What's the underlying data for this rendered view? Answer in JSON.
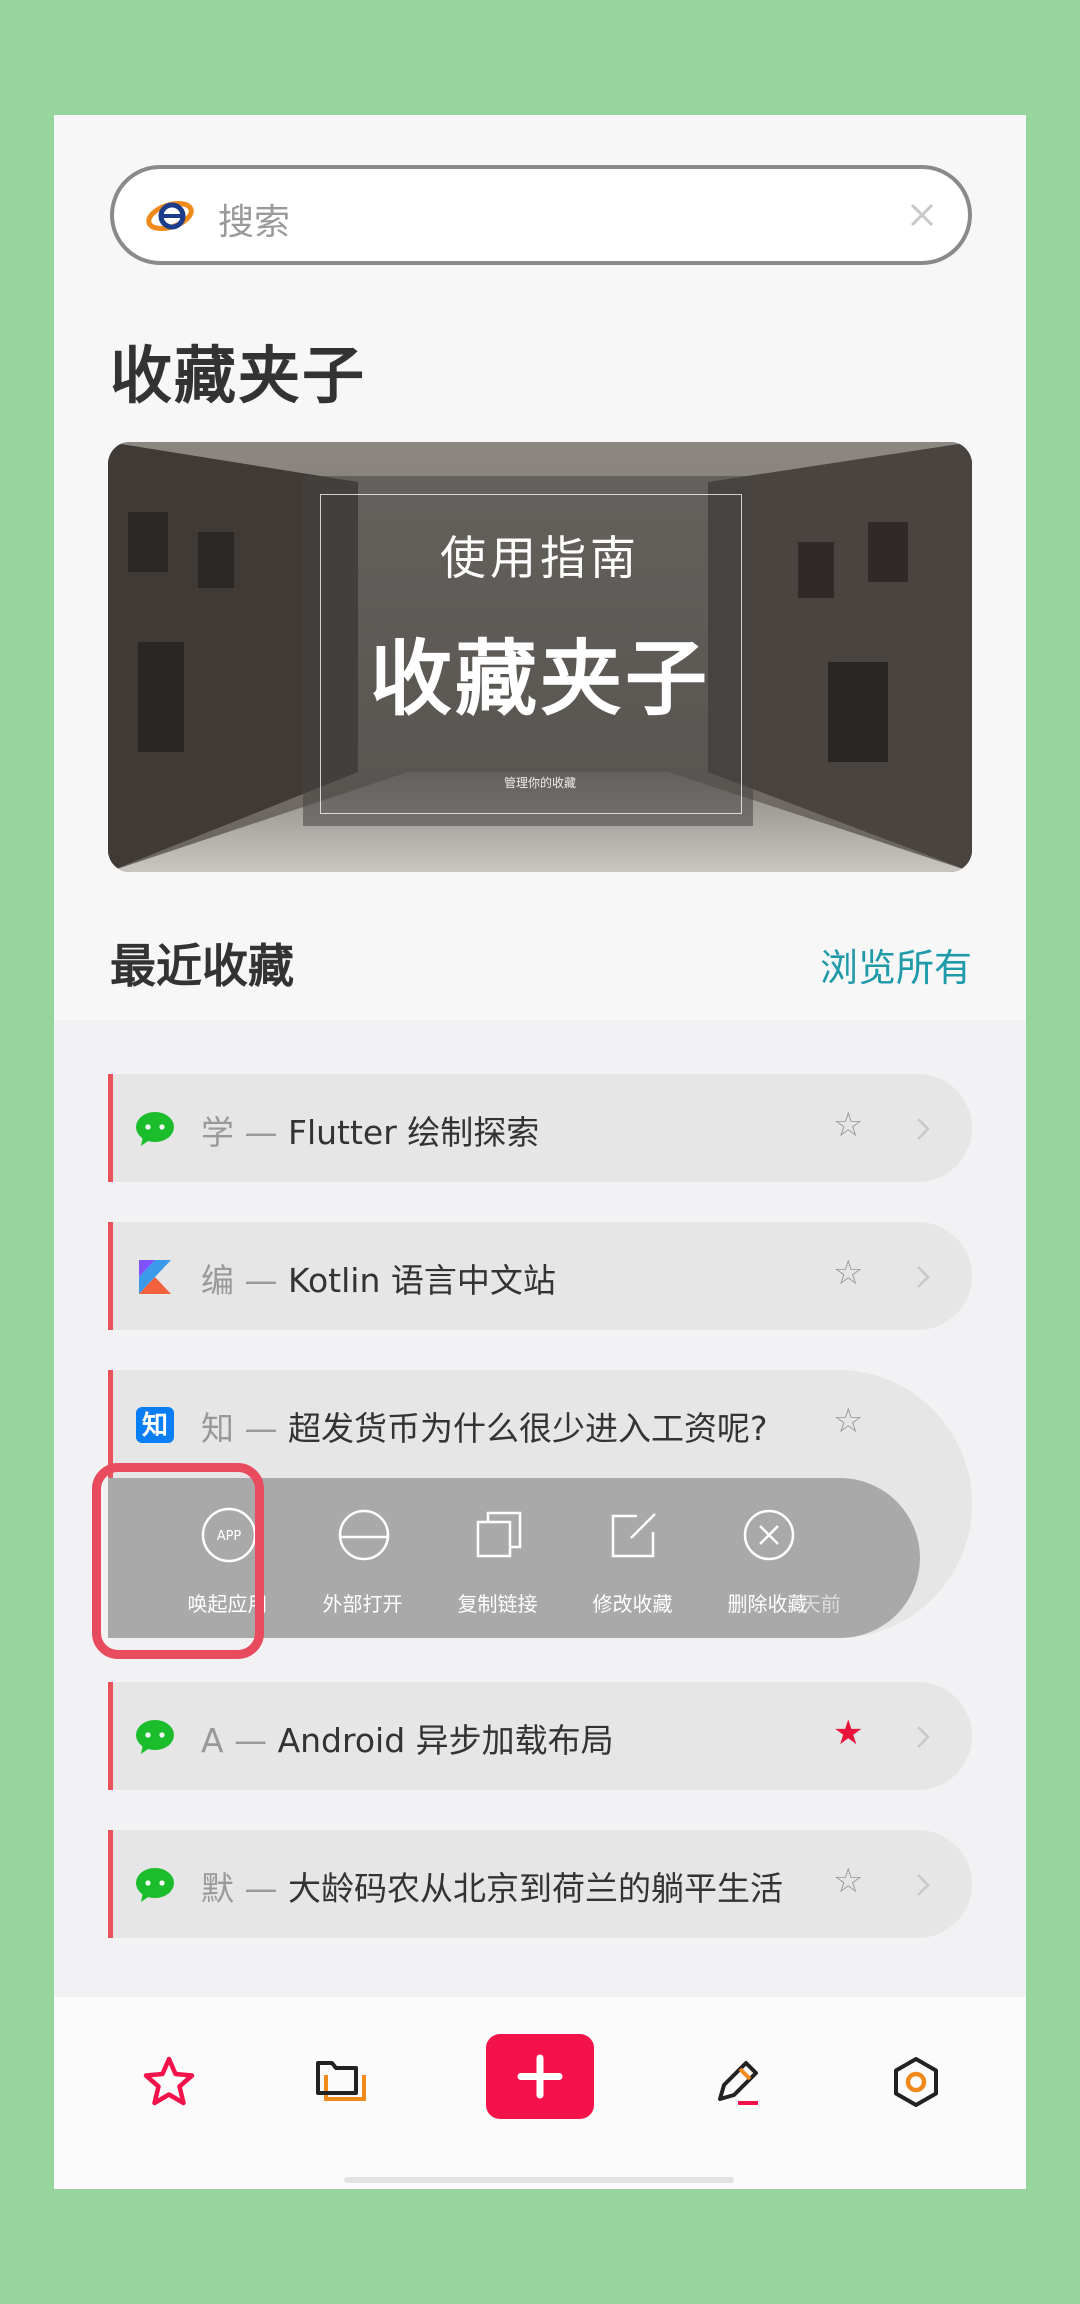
{
  "search": {
    "placeholder": "搜索"
  },
  "page_title": "收藏夹子",
  "banner": {
    "subtitle": "使用指南",
    "title": "收藏夹子",
    "note": "管理你的收藏"
  },
  "recent": {
    "title": "最近收藏",
    "view_all": "浏览所有"
  },
  "items": [
    {
      "icon": "wechat-icon",
      "prefix": "学 — ",
      "title": "Flutter 绘制探索",
      "starred": false
    },
    {
      "icon": "kotlin-icon",
      "prefix": "编 — ",
      "title": "Kotlin 语言中文站",
      "starred": false
    },
    {
      "icon": "zhihu-icon",
      "prefix": "知 — ",
      "title": "超发货币为什么很少进入工资呢?",
      "starred": false
    },
    {
      "icon": "wechat-icon",
      "prefix": "A — ",
      "title": "Android 异步加载布局",
      "starred": true
    },
    {
      "icon": "wechat-icon",
      "prefix": "默 — ",
      "title": "大龄码农从北京到荷兰的躺平生活",
      "starred": false
    }
  ],
  "actions": {
    "open_app": "唤起应用",
    "open_external": "外部打开",
    "copy_link": "复制链接",
    "edit": "修改收藏",
    "delete": "删除收藏",
    "time": "7天前"
  },
  "star_glyph": "☆",
  "star_glyph_on": "★",
  "zhihu_glyph": "知",
  "app_glyph": "APP",
  "colors": {
    "accent": "#f4124b",
    "link": "#1e9aa8",
    "card_bar": "#e8535c",
    "highlight": "#e84b5e",
    "bg": "#96d69e"
  }
}
